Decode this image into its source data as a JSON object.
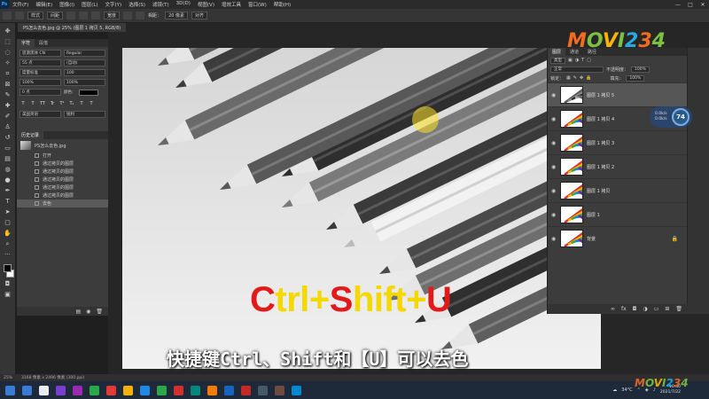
{
  "menubar": {
    "app_logo": "Ps",
    "items": [
      "文件(F)",
      "编辑(E)",
      "图像(I)",
      "图层(L)",
      "文字(Y)",
      "选择(S)",
      "滤镜(T)",
      "3D(D)",
      "视图(V)",
      "增效工具",
      "窗口(W)",
      "帮助(H)"
    ],
    "window_controls": [
      "—",
      "□",
      "✕"
    ]
  },
  "optbar": {
    "mode_label": "样式",
    "spacing": "间距",
    "width_label": "宽度",
    "height_label": "相距：",
    "height_value": "20 像素",
    "align_label": "对齐"
  },
  "document_tab": {
    "title": "PS怎么去色.jpg @ 25% (图层 1 拷贝 5, RGB/8)"
  },
  "character_panel": {
    "tabs": [
      "字符",
      "段落"
    ],
    "font_family": "思源黑体 CN",
    "font_style": "Regular",
    "font_size": "55 点",
    "leading": "(自动)",
    "kerning": "度量标准",
    "tracking": "100",
    "scale_v": "100%",
    "scale_h": "100%",
    "baseline": "0 点",
    "color_label": "颜色：",
    "language": "美国英语",
    "aa": "锐利",
    "type_buttons": [
      "T",
      "T",
      "TT",
      "Tr",
      "T¹",
      "T₁",
      "T",
      "T"
    ]
  },
  "history_panel": {
    "title": "历史记录",
    "source": "PS怎么去色.jpg",
    "items": [
      "打开",
      "通过拷贝的图层",
      "通过拷贝的图层",
      "通过拷贝的图层",
      "通过拷贝的图层",
      "通过拷贝的图层",
      "去色"
    ]
  },
  "layers_panel": {
    "tabs": [
      "图层",
      "通道",
      "路径"
    ],
    "filter": "类型",
    "blend_mode": "正常",
    "opacity_label": "不透明度：",
    "opacity_value": "100%",
    "lock_label": "锁定：",
    "fill_label": "填充：",
    "fill_value": "100%",
    "layers": [
      {
        "name": "图层 1 拷贝 5",
        "selected": true,
        "gray": true
      },
      {
        "name": "图层 1 拷贝 4",
        "selected": false,
        "gray": false
      },
      {
        "name": "图层 1 拷贝 3",
        "selected": false,
        "gray": false
      },
      {
        "name": "图层 1 拷贝 2",
        "selected": false,
        "gray": false
      },
      {
        "name": "图层 1 拷贝",
        "selected": false,
        "gray": false
      },
      {
        "name": "图层 1",
        "selected": false,
        "gray": false
      },
      {
        "name": "背景",
        "selected": false,
        "gray": false
      }
    ]
  },
  "speed_badge": {
    "upload": "0.0k/s",
    "download": "0.0k/s",
    "cpu": "74"
  },
  "statusbar": {
    "zoom": "25%",
    "doc_size": "3168 像素 x 2496 像素 (300 ppi)"
  },
  "taskbar": {
    "weather": "34°C",
    "clock_time": "10:40",
    "clock_date": "2021/7/22",
    "icons": [
      "#3a7bd5",
      "#e8ecf0",
      "#7a3fd0",
      "#9c27b0",
      "#2aa84a",
      "#e53935",
      "#f6b100",
      "#1e88e5",
      "#2aa84a",
      "#d32f2f",
      "#00897b",
      "#f57c00",
      "#1565c0",
      "#c62828",
      "#455a64",
      "#6d4c41",
      "#0288d1"
    ]
  },
  "captions": {
    "key_ctrl": "C",
    "key_trl": "trl",
    "key_plus1": "+",
    "key_shift_s": "S",
    "key_hift": "hift",
    "key_plus2": "+",
    "key_u": "U",
    "subtitle": "快捷键Ctrl、Shift和【U】可以去色"
  },
  "logo": {
    "text": "MOVI234"
  },
  "colors": {
    "accent": "#31a8ff",
    "caption_red": "#e21a1a",
    "caption_yellow": "#f4d800"
  }
}
